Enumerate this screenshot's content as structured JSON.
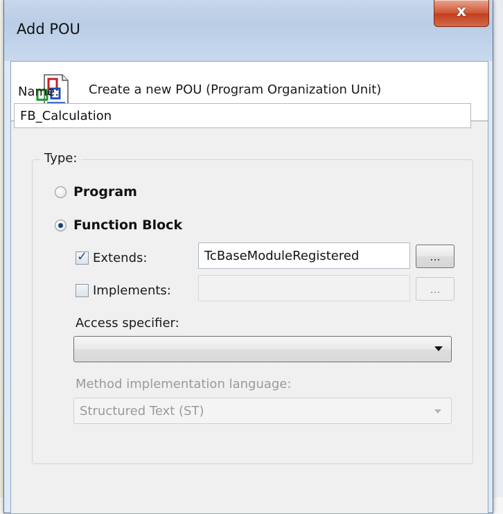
{
  "window": {
    "title": "Add POU",
    "close_label": "x"
  },
  "header": {
    "description": "Create a new POU (Program Organization Unit)",
    "icon": "pou-document-icon"
  },
  "form": {
    "name_label": "Name:",
    "name_value": "FB_Calculation",
    "type_legend": "Type:",
    "program_label": "Program",
    "program_checked": false,
    "function_block_label": "Function Block",
    "function_block_checked": true,
    "extends_label": "Extends:",
    "extends_checked": true,
    "extends_value": "TcBaseModuleRegistered",
    "extends_browse_label": "...",
    "implements_label": "Implements:",
    "implements_checked": false,
    "implements_value": "",
    "implements_browse_label": "...",
    "access_specifier_label": "Access specifier:",
    "access_specifier_value": "",
    "method_language_label": "Method implementation language:",
    "method_language_value": "Structured Text (ST)"
  },
  "colors": {
    "titlebar": "#c7d7ec",
    "close_button": "#c9482a",
    "radio_dot": "#1f3f73"
  }
}
